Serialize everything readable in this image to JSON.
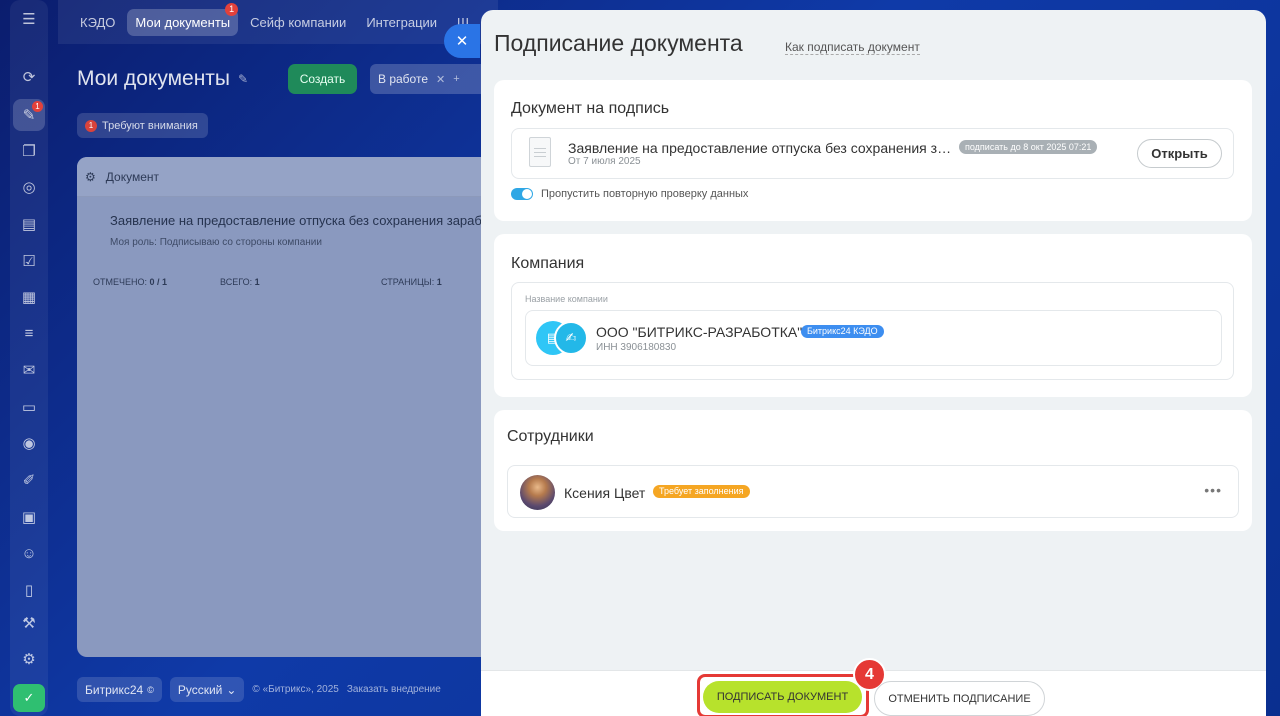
{
  "topnav": {
    "items": [
      "КЭДО",
      "Мои документы",
      "Сейф компании",
      "Интеграции",
      "Ш"
    ],
    "badge": "1"
  },
  "rail": {
    "badge": "1",
    "icons": [
      "refresh-icon",
      "documents-icon",
      "chat-icon",
      "calendar-icon",
      "notes-icon",
      "tasks-icon",
      "schedule-icon",
      "filter-icon",
      "mail-icon",
      "card-icon",
      "target-icon",
      "pen-icon",
      "monitor-icon",
      "users-icon",
      "file-icon",
      "tools-icon",
      "settings-icon",
      "help-icon"
    ]
  },
  "page": {
    "title": "Мои документы",
    "create_label": "Создать",
    "filter_chip": "В работе",
    "filter_plus": "+",
    "attention_count": "1",
    "attention_label": "Требуют внимания",
    "grid_header": "Документ",
    "row_doc": "Заявление на предоставление отпуска без сохранения зараб",
    "row_role": "Моя роль: Подписываю со стороны компании",
    "foot_marked_label": "ОТМЕЧЕНО:",
    "foot_marked": "0 / 1",
    "foot_total_label": "ВСЕГО:",
    "foot_total": "1",
    "foot_pages_label": "СТРАНИЦЫ:",
    "foot_pages": "1"
  },
  "footer": {
    "brand": "Битрикс24",
    "brand_mark": "©",
    "lang": "Русский",
    "copyright": "© «Битрикс», 2025",
    "order": "Заказать внедрение"
  },
  "slider": {
    "title": "Подписание документа",
    "help_link": "Как подписать документ",
    "doc_section_title": "Документ на подпись",
    "doc_name": "Заявление на предоставление отпуска без сохранения за...",
    "doc_date": "От 7 июля 2025",
    "deadline": "подписать до 8 окт 2025 07:21",
    "open_label": "Открыть",
    "toggle_label": "Пропустить повторную проверку данных",
    "company_section_title": "Компания",
    "company_caption": "Название компании",
    "company_name": "ООО \"БИТРИКС-РАЗРАБОТКА\"",
    "company_tag": "Битрикс24 КЭДО",
    "company_inn": "ИНН 3906180830",
    "employees_title": "Сотрудники",
    "employee_name": "Ксения Цвет",
    "employee_tag": "Требует заполнения",
    "more": "•••",
    "sign_label": "ПОДПИСАТЬ ДОКУМЕНТ",
    "cancel_label": "ОТМЕНИТЬ ПОДПИСАНИЕ",
    "step": "4"
  },
  "colors": {
    "accent_green": "#b7e22c",
    "highlight_red": "#e53935",
    "brand_blue": "#2fc6f6",
    "warning_orange": "#f5a623"
  }
}
